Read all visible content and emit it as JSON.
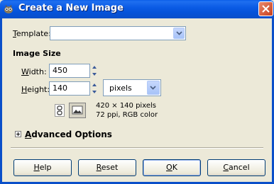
{
  "window": {
    "title": "Create a New Image"
  },
  "template": {
    "label": "Template:",
    "label_accel": "T",
    "label_rest": "emplate:",
    "value": ""
  },
  "image_size": {
    "heading": "Image Size",
    "width": {
      "label_accel": "W",
      "label_rest": "idth:",
      "value": "450"
    },
    "height": {
      "label_accel": "H",
      "label_rest": "eight:",
      "value": "140"
    },
    "unit": "pixels",
    "info_line1": "420 × 140 pixels",
    "info_line2": "72 ppi, RGB color"
  },
  "advanced": {
    "label_accel": "A",
    "label_rest": "dvanced Options"
  },
  "buttons": {
    "help": {
      "accel": "H",
      "rest": "elp"
    },
    "reset": {
      "accel": "R",
      "rest": "eset"
    },
    "ok": {
      "accel": "O",
      "rest": "K"
    },
    "cancel": {
      "accel": "C",
      "rest": "ancel"
    }
  },
  "colors": {
    "title_bar": "#0a5ee8",
    "dialog_bg": "#ece9d8",
    "close": "#c83f1c"
  },
  "icons": [
    "gimp-app-icon",
    "close-icon",
    "chevron-down-icon",
    "spin-up-icon",
    "spin-down-icon",
    "chain-icon",
    "portrait-icon",
    "expand-icon"
  ]
}
